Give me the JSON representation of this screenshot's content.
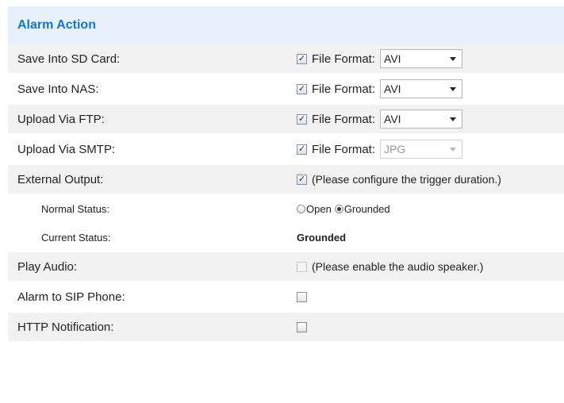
{
  "header": {
    "title": "Alarm Action"
  },
  "rows": [
    {
      "label": "Save Into SD Card:",
      "checked": true,
      "file_format_label": "File Format:",
      "format": "AVI"
    },
    {
      "label": "Save Into NAS:",
      "checked": true,
      "file_format_label": "File Format:",
      "format": "AVI"
    },
    {
      "label": "Upload Via FTP:",
      "checked": true,
      "file_format_label": "File Format:",
      "format": "AVI"
    },
    {
      "label": "Upload Via SMTP:",
      "checked": true,
      "file_format_label": "File Format:",
      "format": "JPG",
      "format_disabled": true
    },
    {
      "label": "External Output:",
      "checked": true,
      "note": "(Please configure the trigger duration.)"
    }
  ],
  "normal_status": {
    "label": "Normal Status:",
    "options": [
      "Open",
      "Grounded"
    ],
    "selected": "Grounded"
  },
  "current_status": {
    "label": "Current Status:",
    "value": "Grounded"
  },
  "play_audio": {
    "label": "Play Audio:",
    "checked": false,
    "disabled": true,
    "note": "(Please enable the audio speaker.)"
  },
  "sip_phone": {
    "label": "Alarm to SIP Phone:",
    "checked": false
  },
  "http_notification": {
    "label": "HTTP Notification:",
    "checked": false
  },
  "colors": {
    "accent": "#1b74c5",
    "header_bg": "#e6f1fb",
    "row_shade": "#f2f2f2"
  }
}
